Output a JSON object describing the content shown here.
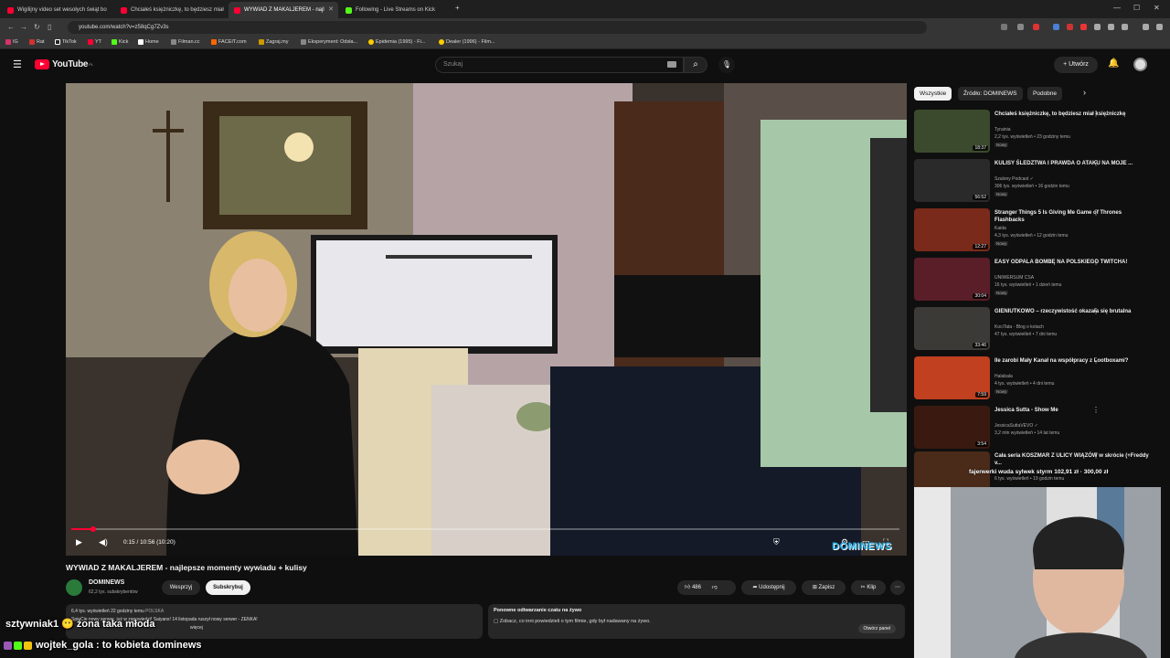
{
  "tabs": [
    {
      "title": "Wigilijny video set wesołych świąt bo"
    },
    {
      "title": "Chciałeś księżniczkę, to będziesz miał"
    },
    {
      "title": "WYWIAD Z MAKALJEREM - najl"
    },
    {
      "title": "Following - Live Streams on Kick"
    }
  ],
  "address": {
    "url": "youtube.com/watch?v=z58qCg7Zv3s"
  },
  "bookmarks": [
    "IG",
    "Rat",
    "TikTok",
    "YT",
    "Kick",
    "Home",
    "Filman.cc",
    "FACEIT.com",
    "Zagraj.my",
    "Eksperyment: Odsła...",
    "Epidemia (1995) - Fi...",
    "Dealer (1996) - Film..."
  ],
  "header": {
    "logo_text": "YouTube",
    "logo_region": "PL",
    "search_placeholder": "Szukaj",
    "create_label": "+ Utwórz"
  },
  "player": {
    "time": "0:15 / 10:56 (10:20)",
    "progress_fraction": 0.023,
    "watermark": "DOMINEWS"
  },
  "video": {
    "title": "WYWIAD Z MAKALJEREM - najlepsze momenty wywiadu + kulisy",
    "channel": "DOMINEWS",
    "subscribers": "62,2 tys. subskrybentów",
    "support_label": "Wesprzyj",
    "subscribe_label": "Subskrybuj",
    "likes": "486",
    "share_label": "Udostępnij",
    "save_label": "Zapisz",
    "clip_label": "Klip",
    "desc_stats": "6,4 tys. wyświetleń  22 godziny temu",
    "desc_country": "POLSKA",
    "desc_line": "SpinCie nowy serwer, już w zapowiedzi! Saiyans! 14 listopada ruszył nowy serwer - ZENKA!",
    "desc_more": "więcej",
    "replay_title": "Ponowne odtwarzanie czatu na żywo",
    "replay_text": "Zobacz, co inni powiedzieli o tym filmie, gdy był nadawany na żywo.",
    "open_panel": "Otwórz panel"
  },
  "chips": [
    "Wszystkie",
    "Źródło: DOMINEWS",
    "Podobne"
  ],
  "recommendations": [
    {
      "title": "Chciałeś księżniczkę, to będziesz miał księżniczkę",
      "channel": "Tyrainia",
      "meta": "2,2 tys. wyświetleń • 23 godziny temu",
      "badge": "Nowy",
      "duration": "18:37",
      "color": "#3b4a2c"
    },
    {
      "title": "KULISY ŚLEDZTWA I PRAWDA O ATAKU NA MOJE ...",
      "channel": "Szalony Podcast ✓",
      "meta": "306 tys. wyświetleń • 16 godzin temu",
      "badge": "Nowy",
      "duration": "56:52",
      "color": "#2a2a2a"
    },
    {
      "title": "Stranger Things 5 Is Giving Me Game of Thrones Flashbacks",
      "channel": "Kaida",
      "meta": "4,3 tys. wyświetleń • 12 godzin temu",
      "badge": "Nowy",
      "duration": "12:27",
      "color": "#7a2a1a"
    },
    {
      "title": "EASY ODPALA BOMBĘ NA POLSKIEGO TWITCHA!",
      "channel": "UNIWERSUM CSA",
      "meta": "16 tys. wyświetleń • 1 dzień temu",
      "badge": "Nowy",
      "duration": "30:04",
      "color": "#5a1e28"
    },
    {
      "title": "GIENIUTKOWO – rzeczywistość okazała się brutalna",
      "channel": "KociTata - Blog o kotach",
      "meta": "47 tys. wyświetleń • 7 dni temu",
      "badge": "",
      "duration": "33:46",
      "color": "#3c3a36"
    },
    {
      "title": "Ile zarobi Mały Kanał na współpracy z Lootboxami?",
      "channel": "Halabala",
      "meta": "4 tys. wyświetleń • 4 dni temu",
      "badge": "Nowy",
      "duration": "7:59",
      "color": "#c04020"
    },
    {
      "title": "Jessica Sutta - Show Me",
      "channel": "JessicaSuttaVEVO ✓",
      "meta": "3,2 mln wyświetleń • 14 lat temu",
      "badge": "",
      "duration": "3:54",
      "color": "#3a1a10"
    },
    {
      "title": "Cała seria KOSZMAR Z ULICY WIĄZÓW w skrócie (+Freddy v...",
      "channel": "",
      "meta": "6 tys. wyświetleń • 19 godzin temu",
      "badge": "",
      "duration": "",
      "color": "#4a2a18"
    }
  ],
  "ticker": "fajerwerki wuda sylwek styrm 102,91 zł  ·  300,00 zł",
  "chat": [
    {
      "user": "sztywniak1",
      "message": "żona taka młoda"
    },
    {
      "user": "wojtek_gola",
      "message": "to kobieta dominews"
    }
  ],
  "colors": {
    "accent": "#ff0033",
    "kick": "#53fc18",
    "bg": "#0f0f0f"
  }
}
